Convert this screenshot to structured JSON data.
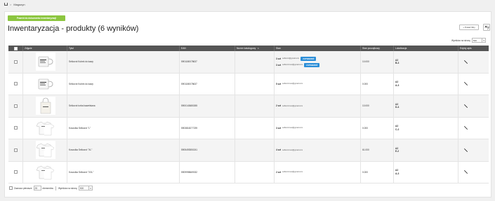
{
  "breadcrumb": {
    "home_icon": "home-icon",
    "separator": ">",
    "current": "Magazyn"
  },
  "toolbar": {
    "back_label": "Powrót do dokumentu inwentaryzacji",
    "filter_label": "Pokaż filtry",
    "close_filter_icon": "filter-off-icon"
  },
  "page": {
    "title": "Inwentaryzacja - produkty (6 wyników)"
  },
  "per_page": {
    "label": "Wyników na stronę",
    "value": "500"
  },
  "table": {
    "columns": {
      "photo": "Zdjęcie",
      "title": "Tytuł",
      "ean": "EAN",
      "catalog": "Numer katalogowy",
      "stock": "Stan",
      "initial": "Stan początkowy",
      "location": "Lokalizacja",
      "edit": "Edytuj wpis"
    },
    "confirm_label": "ZATWIERDŹ",
    "rows": [
      {
        "title": "Sellocrot Kubek do kawy",
        "ean": "5901180078637",
        "stock": [
          {
            "qty": "3 szt",
            "user": "3 szt",
            "email": "sellocrot@gmail.com",
            "confirm": true
          },
          {
            "qty": "3 szt",
            "user": "3 szt",
            "email": "sellocrot.test@gmail.com",
            "confirm": true
          }
        ],
        "initial": "10.000",
        "location": [
          "A2",
          "B-3"
        ]
      },
      {
        "title": "Sellocrot Kubek do kawy",
        "ean": "5901180078637",
        "stock": [
          {
            "qty": "5 szt",
            "email": "sellocrot.test@gmail.com",
            "confirm": false
          }
        ],
        "initial": "0.000",
        "location": [
          "A2",
          "A-3"
        ]
      },
      {
        "title": "Sellocrot torba bawełniana",
        "ean": "5900143680265",
        "stock": [
          {
            "qty": "2 szt",
            "email": "sellocrot.test@gmail.com",
            "confirm": false
          }
        ],
        "initial": "10.000",
        "location": [
          "A2",
          "D-4"
        ]
      },
      {
        "title": "Koszulka Sellocrot \"L\"",
        "ean": "5903818277239",
        "stock": [
          {
            "qty": "3 szt",
            "email": "sellocrot.test@gmail.com",
            "confirm": false
          }
        ],
        "initial": "0.000",
        "location": [
          "A2",
          "C-2"
        ]
      },
      {
        "title": "Koszulka Sellocrot \"XL\"",
        "ean": "5905493550241",
        "stock": [
          {
            "qty": "4 szt",
            "email": "sellocrot.test@gmail.com",
            "confirm": false
          }
        ],
        "initial": "61.000",
        "location": [
          "A2",
          "E-2"
        ]
      },
      {
        "title": "Koszulka Sellocrot \"XXL\"",
        "ean": "5909998669032",
        "stock": [
          {
            "qty": "2 szt",
            "email": "sellocrot.test@gmail.com",
            "confirm": false
          }
        ],
        "initial": "0.000",
        "location": [
          "A2",
          "A-3"
        ]
      }
    ]
  },
  "footer": {
    "select_first_label": "Zaznacz pierwsze",
    "select_first_value": "25",
    "elements_label": "elementów",
    "per_page_label": "Wyników na stronę",
    "per_page_value": "500"
  },
  "colors": {
    "accent_green": "#8cc63f",
    "confirm_blue": "#2d8fd8",
    "header_gray": "#555555"
  }
}
